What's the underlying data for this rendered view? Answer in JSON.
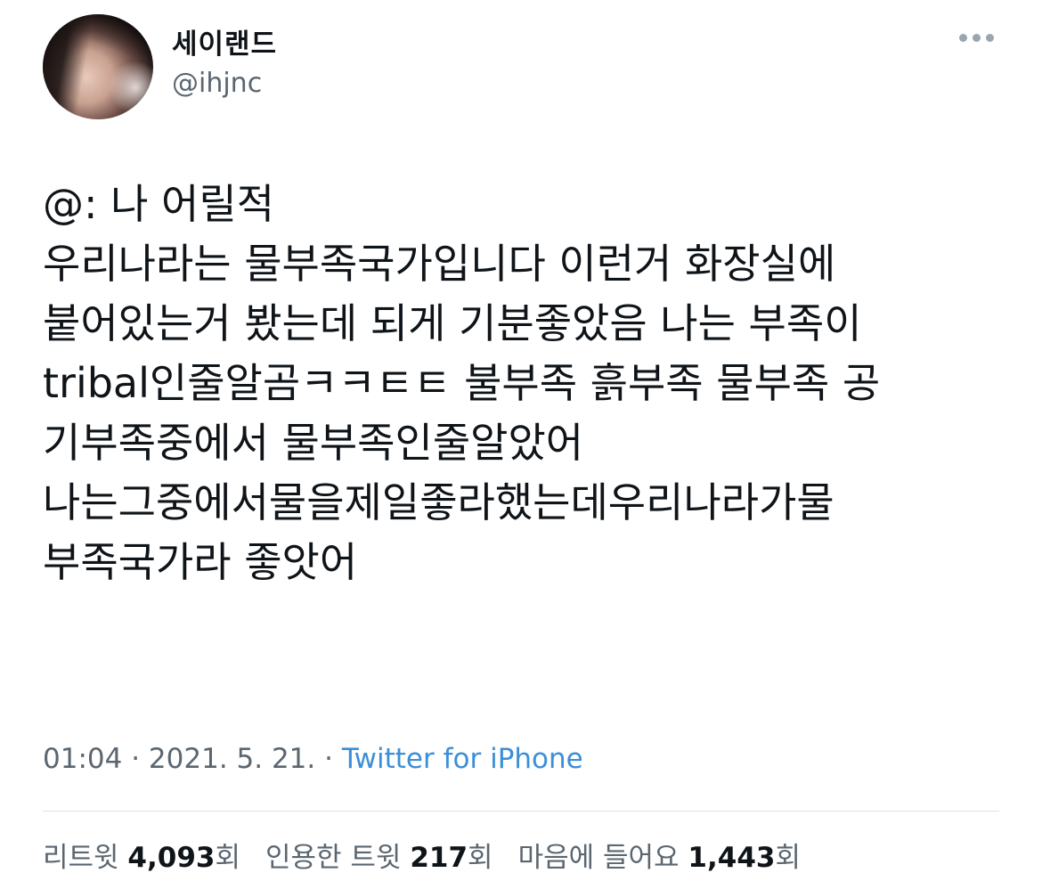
{
  "author": {
    "display_name": "세이랜드",
    "handle": "@ihjnc"
  },
  "tweet": {
    "text": "@: 나 어릴적\n우리나라는 물부족국가입니다 이런거 화장실에\n붙어있는거 봤는데 되게 기분좋았음 나는 부족이\ntribal인줄알곰ㅋㅋㅌㅌ 불부족 흙부족 물부족 공\n기부족중에서 물부족인줄알았어\n나는그중에서물을제일좋라했는데우리나라가물\n부족국가라 좋앗어",
    "time": "01:04",
    "date": "2021. 5. 21.",
    "separator": "·",
    "source": "Twitter for iPhone"
  },
  "stats": {
    "retweets_label": "리트윗",
    "retweets_count": "4,093",
    "quotes_label": "인용한 트윗",
    "quotes_count": "217",
    "likes_label": "마음에 들어요",
    "likes_count": "1,443",
    "unit": "회"
  },
  "icons": {
    "more": "more-dots-icon"
  },
  "colors": {
    "link": "#3b8fd9",
    "secondary_text": "#5b6670"
  }
}
